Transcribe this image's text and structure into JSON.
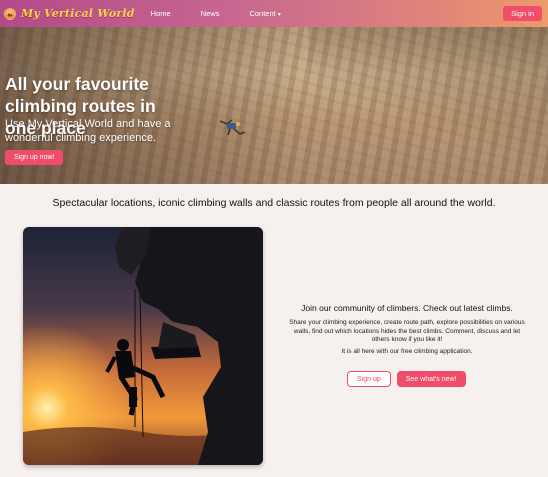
{
  "header": {
    "logo_text": "My Vertical World",
    "nav": [
      {
        "label": "Home"
      },
      {
        "label": "News"
      },
      {
        "label": "Content"
      }
    ],
    "signin_label": "Sign in"
  },
  "hero": {
    "title": "All your favourite climbing routes in one place",
    "subtitle": "Use My Vertical World and have a wonderful climbing experience.",
    "cta_label": "Sign up now!"
  },
  "tagline": "Spectacular locations, iconic climbing walls and classic routes from people all around the world.",
  "community": {
    "heading": "Join our community of climbers. Check out latest climbs.",
    "body": "Share your climbing experience, create route path, explore possibilities on various walls, find out which locations hides the best climbs. Comment, discuss and let others know if you like it!",
    "body2": "It is all here with our free climbing application.",
    "signup_label": "Sign up",
    "whats_new_label": "See what's new!"
  },
  "colors": {
    "accent": "#f04d6a",
    "header_gradient_start": "#b24a8a",
    "header_gradient_end": "#ee9a6a",
    "logo": "#ffd04a"
  },
  "icons": {
    "logo": "sunset-mountain-icon",
    "dropdown": "chevron-down-icon"
  }
}
